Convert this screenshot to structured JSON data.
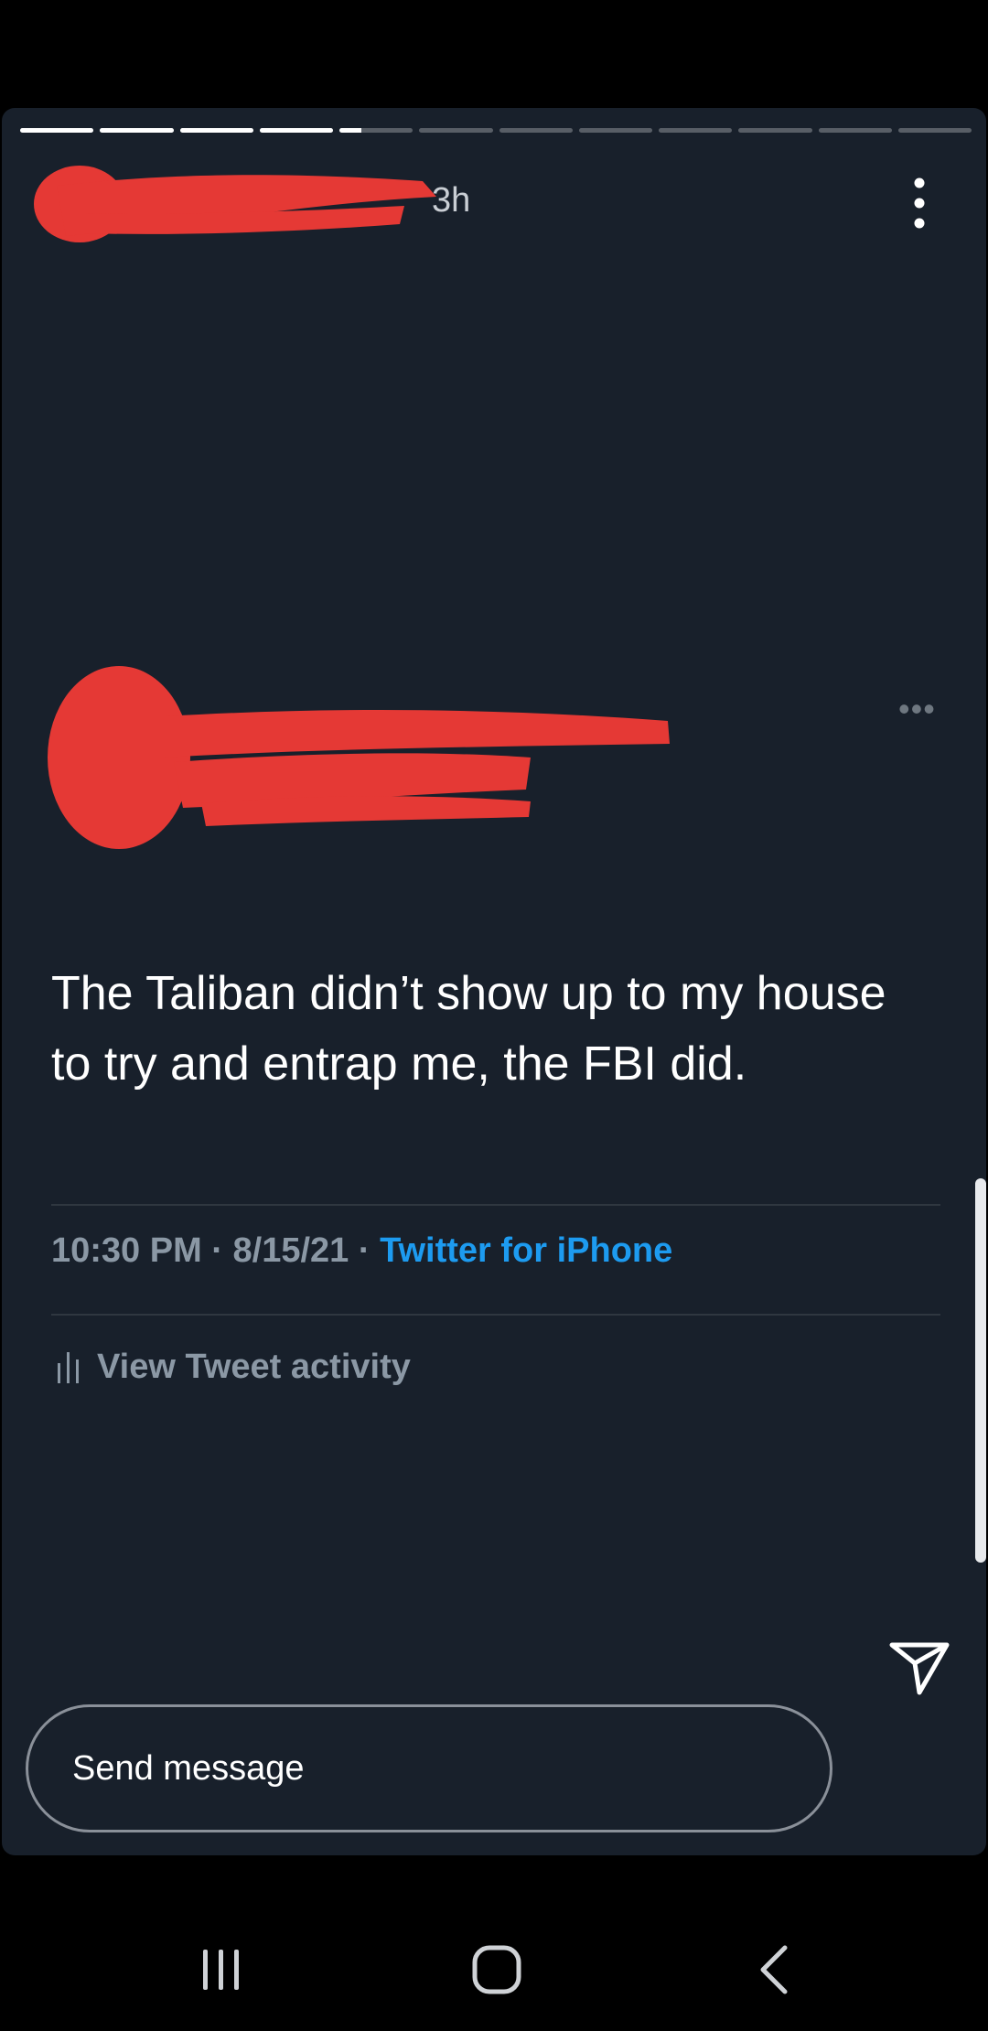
{
  "story": {
    "progress": {
      "total_segments": 12,
      "completed_segments": 4,
      "current_segment_fraction": 0.3
    },
    "header": {
      "time_ago": "3h"
    }
  },
  "tweet": {
    "text": "The Taliban didn’t show up to my house to try and entrap me, the FBI did.",
    "timestamp": "10:30 PM · 8/15/21 · ",
    "source": "Twitter for iPhone",
    "activity_label": "View Tweet activity",
    "more_label": "•••"
  },
  "composer": {
    "placeholder": "Send message"
  },
  "colors": {
    "background": "#18202b",
    "accent": "#1d9bf0",
    "redaction": "#e53935"
  },
  "icons": {
    "more": "more-vert-icon",
    "send": "send-icon",
    "activity": "bar-chart-icon",
    "nav": [
      "recent-apps-icon",
      "home-icon",
      "back-icon"
    ]
  }
}
